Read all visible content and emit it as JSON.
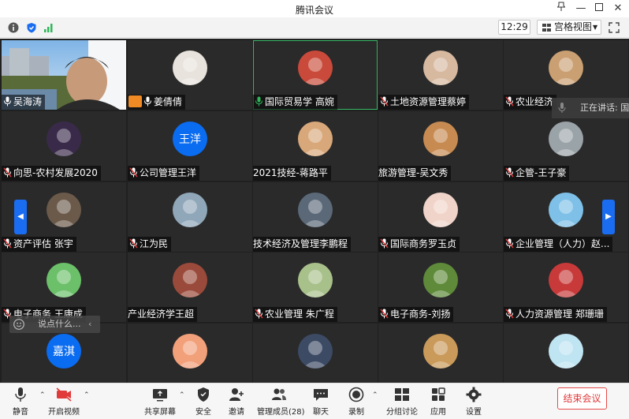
{
  "window": {
    "title": "腾讯会议"
  },
  "infobar": {
    "time": "12:29",
    "view_label": "宫格视图"
  },
  "speaking": {
    "label": "正在讲话: 国际"
  },
  "chat_hint": {
    "placeholder": "说点什么..."
  },
  "participants": [
    {
      "name": "吴海涛",
      "kind": "video"
    },
    {
      "name": "姜倩倩",
      "kind": "photo",
      "host": true,
      "avatar_color": "#e8e3dc"
    },
    {
      "name": "国际贸易学 高婉",
      "kind": "cartoon",
      "active": true,
      "avatar_color": "#c94a3a",
      "mic_color": "#2fb65a"
    },
    {
      "name": "土地资源管理蔡婷",
      "kind": "photo",
      "avatar_color": "#d7b9a0"
    },
    {
      "name": "农业经济",
      "kind": "photo",
      "avatar_color": "#caa073"
    },
    {
      "name": "向思-农村发展2020",
      "kind": "photo",
      "avatar_color": "#3a2a4a"
    },
    {
      "name": "公司管理王洋",
      "kind": "text",
      "avatar_text": "王洋",
      "avatar_color": "#0a6cf1"
    },
    {
      "name": "2021技经-蒋路平",
      "kind": "photo",
      "no_mic": true,
      "avatar_color": "#d9a87a"
    },
    {
      "name": "旅游管理-吴文秀",
      "kind": "photo",
      "no_mic": true,
      "avatar_color": "#c78b52"
    },
    {
      "name": "企管-王子豪",
      "kind": "photo",
      "avatar_color": "#9aa3a8"
    },
    {
      "name": "资产评估 张宇",
      "kind": "photo",
      "avatar_color": "#6b5a4a"
    },
    {
      "name": "江为民",
      "kind": "photo",
      "avatar_color": "#8fa7b8"
    },
    {
      "name": "技术经济及管理李鹏程",
      "kind": "cartoon",
      "no_mic": true,
      "avatar_color": "#5a6878"
    },
    {
      "name": "国际商务罗玉贞",
      "kind": "cartoon",
      "avatar_color": "#f0d4c9"
    },
    {
      "name": "企业管理（人力）赵...",
      "kind": "cartoon",
      "avatar_color": "#7ec0e8"
    },
    {
      "name": "电子商务 王康成",
      "kind": "cartoon",
      "avatar_color": "#6cc06a"
    },
    {
      "name": "产业经济学王超",
      "kind": "photo",
      "no_mic": true,
      "avatar_color": "#9a4a3a"
    },
    {
      "name": "农业管理 朱广程",
      "kind": "cartoon",
      "avatar_color": "#a8c08a"
    },
    {
      "name": "电子商务-刘扬",
      "kind": "photo",
      "avatar_color": "#5e8a3a"
    },
    {
      "name": "人力资源管理 郑珊珊",
      "kind": "cartoon",
      "avatar_color": "#c83a3a"
    },
    {
      "name": "",
      "kind": "text",
      "avatar_text": "嘉淇",
      "avatar_color": "#0a6cf1",
      "clipped": true
    },
    {
      "name": "",
      "kind": "cartoon",
      "avatar_color": "#f2a07a",
      "clipped": true
    },
    {
      "name": "",
      "kind": "photo",
      "avatar_color": "#3c4a64",
      "clipped": true
    },
    {
      "name": "",
      "kind": "photo",
      "avatar_color": "#c99a5a",
      "clipped": true
    },
    {
      "name": "",
      "kind": "cartoon",
      "avatar_color": "#bfe4f2",
      "clipped": true
    }
  ],
  "toolbar": {
    "mute": "静音",
    "video": "开启视频",
    "share": "共享屏幕",
    "security": "安全",
    "invite": "邀请",
    "members": "管理成员(28)",
    "chat": "聊天",
    "record": "录制",
    "breakout": "分组讨论",
    "apps": "应用",
    "settings": "设置",
    "end": "结束会议"
  },
  "colors": {
    "accent": "#1a6cf0",
    "active_border": "#35b865",
    "end": "#e03a3a",
    "host_badge": "#f08a24"
  }
}
